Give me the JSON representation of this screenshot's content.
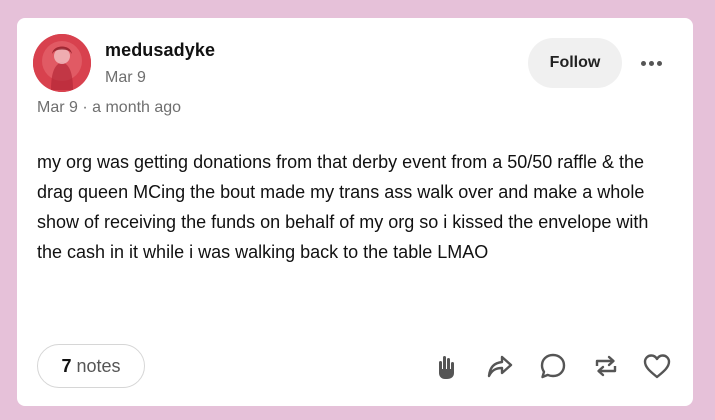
{
  "post": {
    "username": "medusadyke",
    "date_short": "Mar 9",
    "date_full": "Mar 9 · a month ago",
    "body": "my org was getting donations from that derby event from a 50/50 raffle & the drag queen MCing the bout made my trans ass walk over and make a whole show of receiving the funds on behalf of my org so i kissed the envelope with the cash in it while i was walking back to the table LMAO"
  },
  "header": {
    "follow_label": "Follow",
    "more_icon": "more-horizontal-icon"
  },
  "footer": {
    "notes_count": "7",
    "notes_label": "notes",
    "actions": [
      "hand-icon",
      "share-icon",
      "reply-icon",
      "reblog-icon",
      "like-icon"
    ]
  },
  "colors": {
    "background": "#e6c1d9",
    "card": "#ffffff",
    "avatar": "#d9414f",
    "text": "#111111",
    "muted": "#6f6f6f"
  }
}
